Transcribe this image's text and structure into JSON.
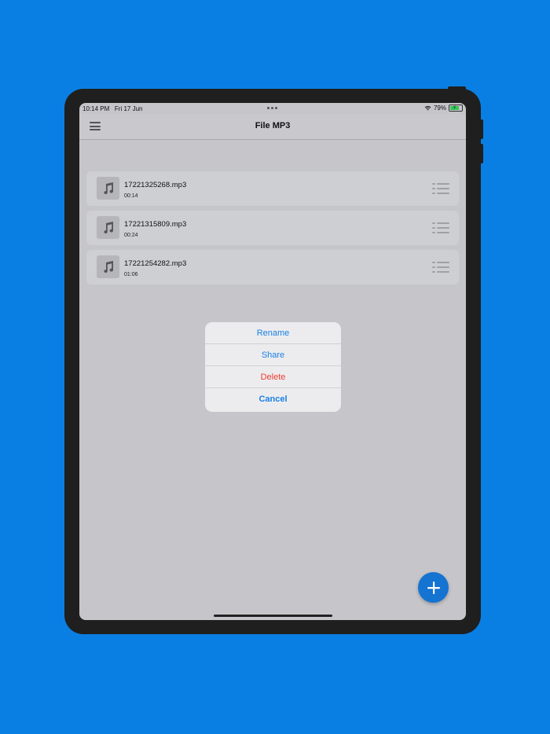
{
  "status_bar": {
    "time": "10:14 PM",
    "date": "Fri 17 Jun",
    "battery": "79%",
    "wifi_icon": "wifi-icon",
    "battery_icon": "battery-charging-icon"
  },
  "navbar": {
    "title": "File MP3",
    "menu_icon": "hamburger-icon"
  },
  "files": [
    {
      "name": "17221325268.mp3",
      "duration": "00:14"
    },
    {
      "name": "17221315809.mp3",
      "duration": "00:24"
    },
    {
      "name": "17221254282.mp3",
      "duration": "01:06"
    }
  ],
  "action_sheet": {
    "rename": "Rename",
    "share": "Share",
    "delete": "Delete",
    "cancel": "Cancel"
  },
  "fab": {
    "icon": "plus-icon"
  },
  "colors": {
    "background": "#0a7fe3",
    "accent": "#1a80e5",
    "destructive": "#ee3b30",
    "fab": "#1573d1"
  }
}
